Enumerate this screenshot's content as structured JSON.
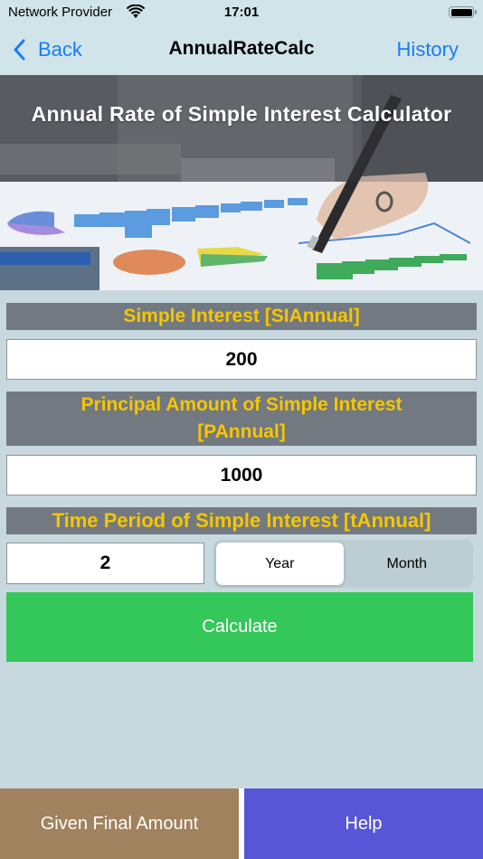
{
  "status_bar": {
    "carrier": "Network Provider",
    "time": "17:01",
    "wifi_icon": "wifi-icon",
    "battery_icon": "battery-full-icon"
  },
  "nav": {
    "back_label": "Back",
    "back_icon": "chevron-left-icon",
    "title": "AnnualRateCalc",
    "history_label": "History"
  },
  "banner": {
    "title": "Annual Rate of Simple Interest Calculator",
    "image": "hand-writing-on-charts-photo"
  },
  "form": {
    "simple_interest": {
      "label": "Simple Interest [SIAnnual]",
      "value": "200"
    },
    "principal": {
      "label": "Principal Amount of Simple Interest [PAnnual]",
      "value": "1000"
    },
    "time_period": {
      "label": "Time Period of Simple Interest [tAnnual]",
      "value": "2",
      "units": [
        {
          "label": "Year",
          "selected": true
        },
        {
          "label": "Month",
          "selected": false
        }
      ]
    },
    "calculate_label": "Calculate"
  },
  "bottom": {
    "left_label": "Given Final Amount",
    "right_label": "Help"
  },
  "colors": {
    "background": "#c7d9df",
    "label_bg": "#727980",
    "label_text": "#f7c600",
    "link_blue": "#1a7cf5",
    "calculate_green": "#34c759",
    "final_amount_brown": "#a0825e",
    "help_purple": "#5656d6"
  }
}
